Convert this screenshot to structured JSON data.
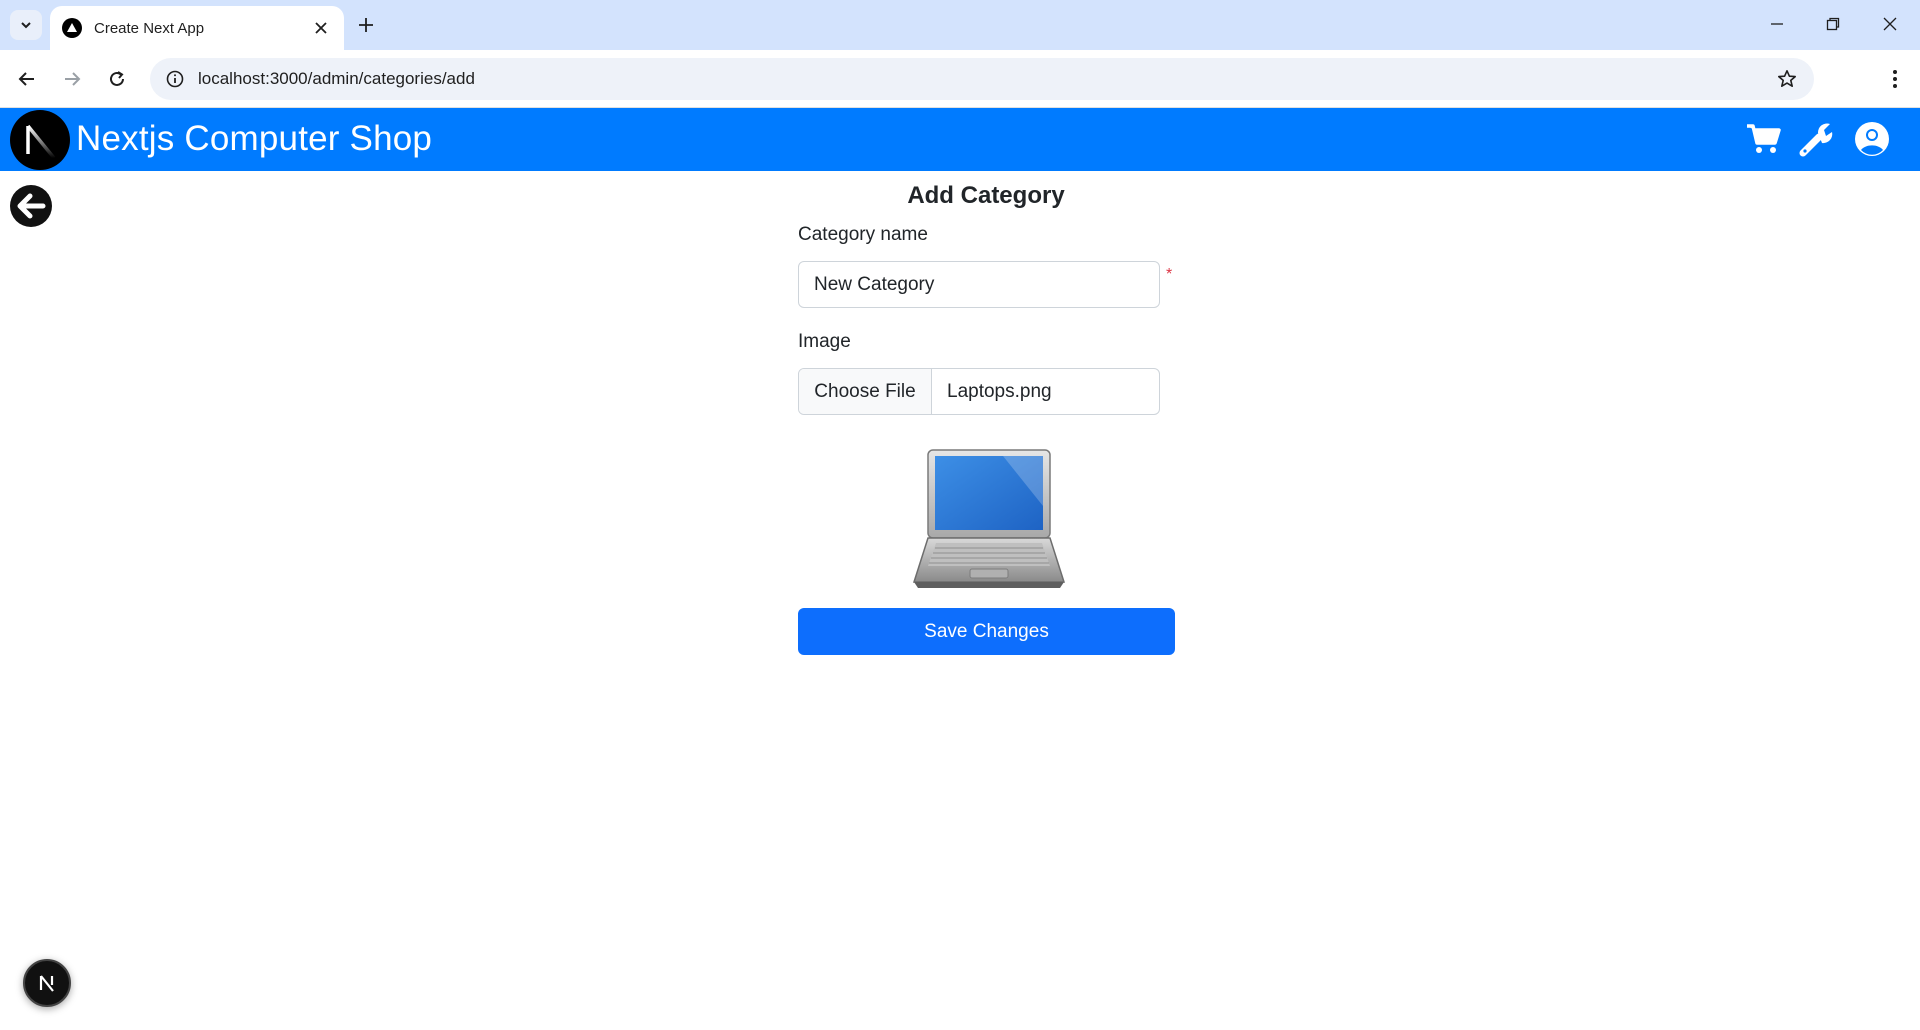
{
  "browser": {
    "tab_title": "Create Next App",
    "url": "localhost:3000/admin/categories/add"
  },
  "navbar": {
    "brand": "Nextjs Computer Shop",
    "brand_logo_letter": "N",
    "color": "#007bff"
  },
  "page": {
    "title": "Add Category"
  },
  "form": {
    "category_name_label": "Category name",
    "category_name_value": "New Category",
    "required_marker": "*",
    "image_label": "Image",
    "choose_file_label": "Choose File",
    "file_name": "Laptops.png",
    "save_label": "Save Changes"
  },
  "dev_badge": {
    "letter": "N"
  },
  "icons": [
    "chevron-down-icon",
    "close-icon",
    "plus-icon",
    "minimize-icon",
    "restore-icon",
    "back-arrow-icon",
    "forward-arrow-icon",
    "reload-icon",
    "info-icon",
    "star-icon",
    "kebab-menu-icon",
    "cart-icon",
    "wrench-icon",
    "user-circle-icon",
    "arrow-left-circle-icon",
    "laptop-image"
  ]
}
